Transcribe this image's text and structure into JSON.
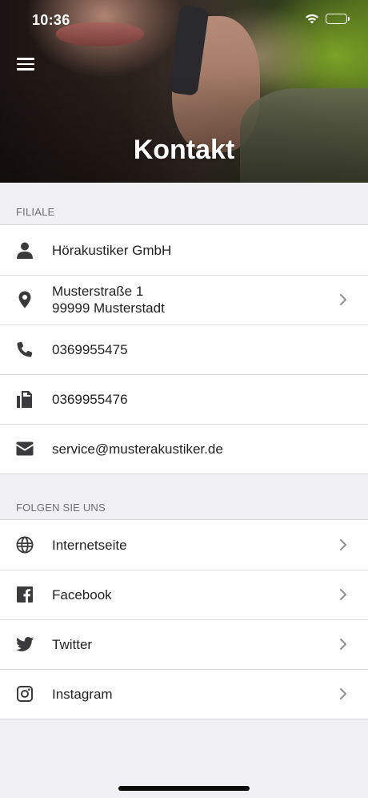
{
  "status_bar": {
    "time": "10:36",
    "wifi_icon": "wifi-icon",
    "battery_icon": "battery-icon"
  },
  "header": {
    "title": "Kontakt",
    "menu_icon": "hamburger-menu-icon"
  },
  "sections": {
    "filiale": {
      "title": "FILIALE",
      "company": "Hörakustiker GmbH",
      "address_line1": "Musterstraße 1",
      "address_line2": "99999 Musterstadt",
      "phone": "0369955475",
      "fax": "0369955476",
      "email": "service@musterakustiker.de"
    },
    "social": {
      "title": "FOLGEN SIE UNS",
      "items": [
        {
          "label": "Internetseite",
          "icon": "globe-icon"
        },
        {
          "label": "Facebook",
          "icon": "facebook-icon"
        },
        {
          "label": "Twitter",
          "icon": "twitter-icon"
        },
        {
          "label": "Instagram",
          "icon": "instagram-icon"
        }
      ]
    }
  },
  "colors": {
    "icon": "#3b3b3d",
    "background": "#efeff4",
    "chevron": "#8e8e93"
  }
}
